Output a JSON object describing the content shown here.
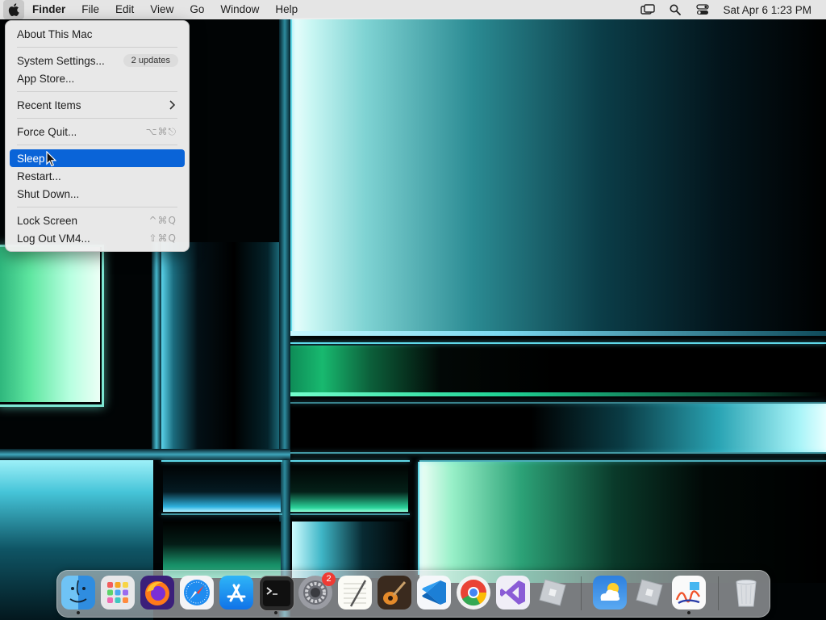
{
  "menubar": {
    "app_name": "Finder",
    "menus": [
      "File",
      "Edit",
      "View",
      "Go",
      "Window",
      "Help"
    ],
    "clock": "Sat Apr 6  1:23 PM",
    "status_icons": [
      "screen-mirroring-icon",
      "spotlight-search-icon",
      "control-center-icon"
    ]
  },
  "apple_menu": {
    "about": "About This Mac",
    "system_settings": "System Settings...",
    "updates_badge": "2 updates",
    "app_store": "App Store...",
    "recent_items": "Recent Items",
    "force_quit": "Force Quit...",
    "force_quit_shortcut": "⌥⌘⎋",
    "sleep": "Sleep",
    "restart": "Restart...",
    "shut_down": "Shut Down...",
    "lock_screen": "Lock Screen",
    "lock_screen_shortcut": "^⌘Q",
    "log_out": "Log Out VM4...",
    "log_out_shortcut": "⇧⌘Q",
    "highlighted": "Sleep"
  },
  "dock": {
    "apps": [
      "Finder",
      "Launchpad",
      "Firefox",
      "Safari",
      "App Store",
      "Terminal",
      "System Settings",
      "TextEdit",
      "GarageBand",
      "Visual Studio Code",
      "Google Chrome",
      "Visual Studio",
      "Roblox",
      "Weather",
      "Roblox Studio",
      "Freeform",
      "Trash"
    ],
    "system_settings_badge": "2"
  },
  "colors": {
    "highlight": "#0a64d8",
    "badge": "#ef3b34"
  }
}
